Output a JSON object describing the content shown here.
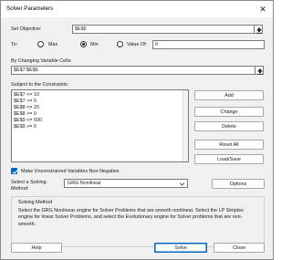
{
  "window": {
    "title": "Solver Parameters",
    "close_glyph": "✕"
  },
  "objective": {
    "label": "Set Objective:",
    "value": "$E$5"
  },
  "to": {
    "label": "To:",
    "options": [
      {
        "label": "Max",
        "selected": false
      },
      {
        "label": "Min",
        "selected": true
      },
      {
        "label": "Value Of:",
        "selected": false
      }
    ],
    "value_of": "0"
  },
  "variable_cells": {
    "label": "By Changing Variable Cells:",
    "value": "$E$7:$E$9"
  },
  "constraints": {
    "label": "Subject to the Constraints:",
    "items": [
      "$E$7 <= 10",
      "$E$7 >= 0",
      "$E$8 <= 20",
      "$E$8 >= 0",
      "$E$9 <= 500",
      "$E$9 >= 0"
    ]
  },
  "side_buttons": {
    "add": "Add",
    "change": "Change",
    "delete": "Delete",
    "reset_all": "Reset All",
    "load_save": "Load/Save"
  },
  "nonnegative": {
    "label": "Make Unconstrained Variables Non-Negative",
    "checked": true
  },
  "method": {
    "label_line1": "Select a Solving",
    "label_line2": "Method:",
    "selected": "GRG Nonlinear",
    "options_button": "Options"
  },
  "solving_method": {
    "title": "Solving Method",
    "text": "Select the GRG Nonlinear engine for Solver Problems that are smooth nonlinear. Select the LP Simplex engine for linear Solver Problems, and select the Evolutionary engine for Solver problems that are non-smooth."
  },
  "footer": {
    "help": "Help",
    "solve": "Solve",
    "close": "Close"
  },
  "colors": {
    "accent": "#0067c0",
    "dialog_bg": "#f0f0f0",
    "field_border": "#7a7a7a"
  },
  "icons": {
    "range_picker": "collapse-arrow-icon",
    "dropdown": "chevron-down-icon",
    "check": "checkmark-icon"
  }
}
